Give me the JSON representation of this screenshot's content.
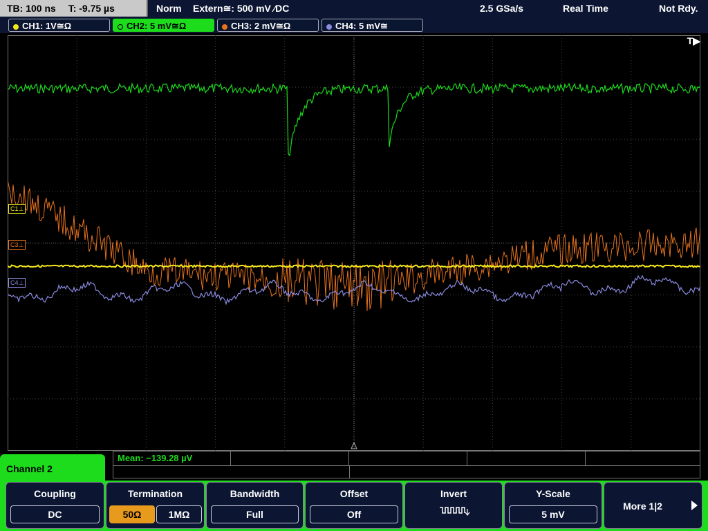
{
  "status": {
    "timebase": "TB: 100 ns",
    "trigger_time": "T: -9.75 µs",
    "mode": "Norm",
    "trigger_source": "Extern≅: 500 mV ⁄DC",
    "sample_rate": "2.5 GSa/s",
    "acq_mode": "Real Time",
    "state": "Not Rdy."
  },
  "channels": [
    {
      "label": "CH1: 1V≅Ω",
      "color": "#f4e81c"
    },
    {
      "label": "CH2: 5 mV≅Ω",
      "color": "#1cdc1c"
    },
    {
      "label": "CH3: 2 mV≅Ω",
      "color": "#e8731c"
    },
    {
      "label": "CH4: 5 mV≅",
      "color": "#8a8ae0"
    }
  ],
  "grid": {
    "trigger_indicator": "T▶",
    "markers": [
      {
        "label": "C1⊥",
        "color": "#f4e81c"
      },
      {
        "label": "C3⊥",
        "color": "#e8731c"
      },
      {
        "label": "C4⊥",
        "color": "#8a8ae0"
      }
    ]
  },
  "measurement": {
    "text": "Mean: −139.28 µV"
  },
  "menu": {
    "channel_title": "Channel 2",
    "coupling": {
      "title": "Coupling",
      "value": "DC"
    },
    "termination": {
      "title": "Termination",
      "opt1": "50Ω",
      "opt2": "1MΩ"
    },
    "bandwidth": {
      "title": "Bandwidth",
      "value": "Full"
    },
    "offset": {
      "title": "Offset",
      "value": "Off"
    },
    "invert": {
      "title": "Invert",
      "icon": "invert-wave-icon"
    },
    "yscale": {
      "title": "Y-Scale",
      "value": "5 mV"
    },
    "more": {
      "label": "More 1|2",
      "icon": "arrow-right-icon"
    }
  }
}
